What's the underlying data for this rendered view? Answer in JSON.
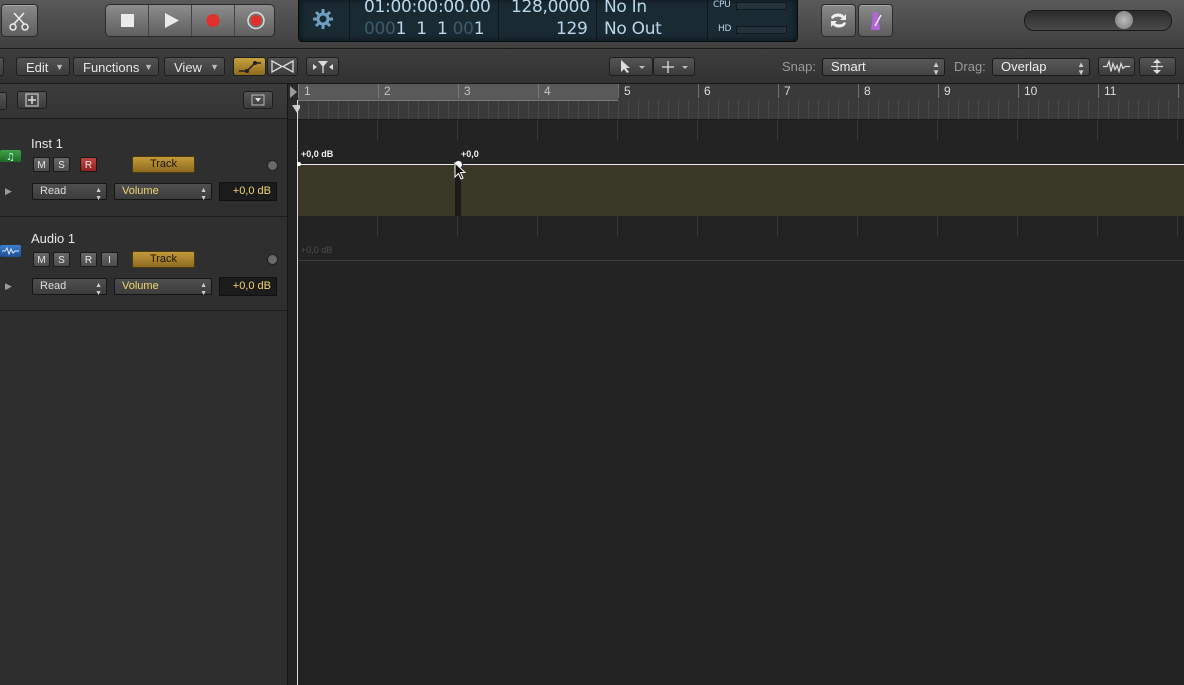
{
  "transport": {
    "timecode": "01:00:00:00.00",
    "position_dim1": "000",
    "position_bars": "1  1  1",
    "position_dim2": "00",
    "position_tick": "1",
    "tempo": "128,0000",
    "signature": "129",
    "in": "No In",
    "out": "No Out",
    "cpu_label": "CPU",
    "hd_label": "HD"
  },
  "toolbar": {
    "edit": "Edit",
    "functions": "Functions",
    "view": "View",
    "snap_label": "Snap:",
    "snap_value": "Smart",
    "drag_label": "Drag:",
    "drag_value": "Overlap"
  },
  "ruler": {
    "bars": [
      "1",
      "2",
      "3",
      "4",
      "5",
      "6",
      "7",
      "8",
      "9",
      "10",
      "11",
      "1"
    ]
  },
  "tracks": [
    {
      "name": "Inst 1",
      "mute": "M",
      "solo": "S",
      "rec": "R",
      "track_button": "Track",
      "automation_mode": "Read",
      "automation_param": "Volume",
      "value": "+0,0 dB"
    },
    {
      "name": "Audio 1",
      "mute": "M",
      "solo": "S",
      "rec": "R",
      "input": "I",
      "track_button": "Track",
      "automation_mode": "Read",
      "automation_param": "Volume",
      "value": "+0,0 dB"
    }
  ],
  "automation": {
    "inst1_start_label": "+0,0 dB",
    "inst1_point_label": "+0,0",
    "audio1_label": "+0,0 dB"
  },
  "colors": {
    "track_button": "#c49a3a",
    "record": "#c0433f",
    "lcd_text": "#b9d7e8",
    "value_text": "#f0d770"
  }
}
